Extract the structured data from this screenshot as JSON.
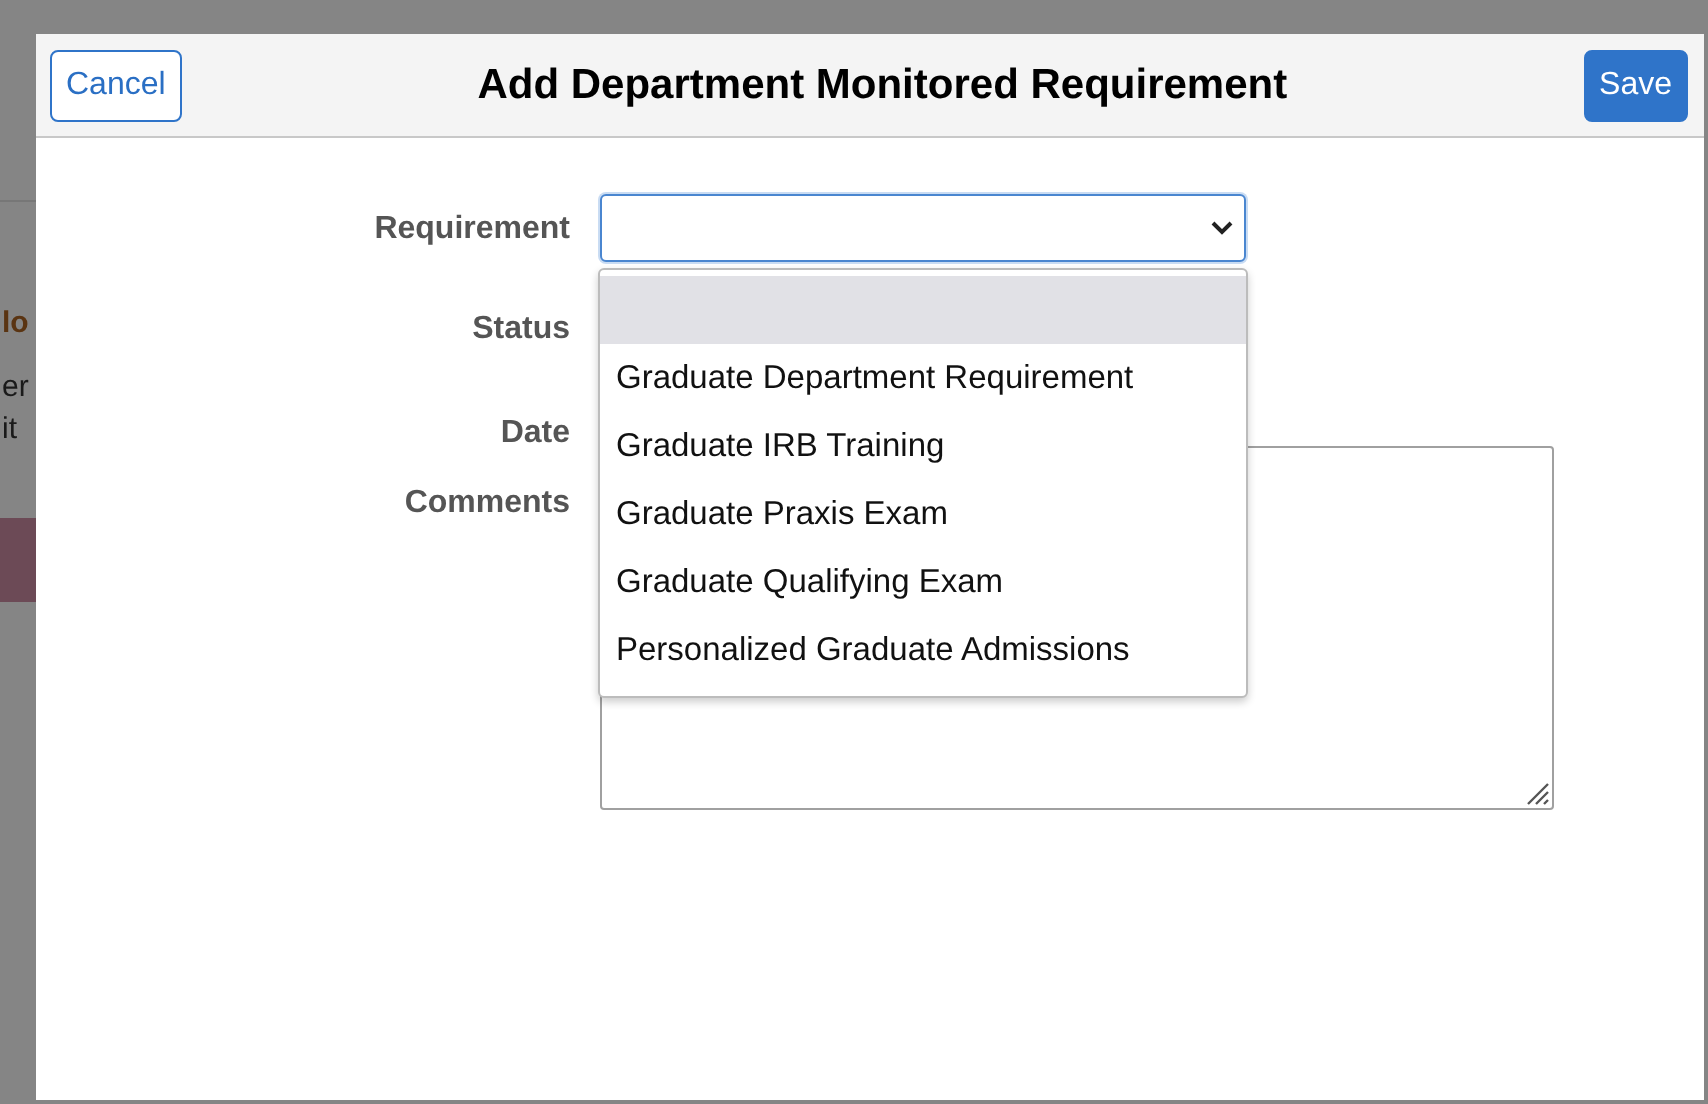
{
  "background_fragments": [
    {
      "text": "lo",
      "kind": "heading"
    },
    {
      "text": "er",
      "kind": "body"
    },
    {
      "text": "it",
      "kind": "body"
    }
  ],
  "dialog": {
    "title": "Add Department Monitored Requirement",
    "cancel_button": "Cancel",
    "save_button": "Save"
  },
  "form": {
    "requirement": {
      "label": "Requirement",
      "expanded": true,
      "options": [
        {
          "selected": true
        },
        {
          "label": "Graduate Department Requirement",
          "selected": false
        },
        {
          "label": "Graduate IRB Training",
          "selected": false
        },
        {
          "label": "Graduate Praxis Exam",
          "selected": false
        },
        {
          "label": "Graduate Qualifying Exam",
          "selected": false
        },
        {
          "label": "Personalized Graduate Admissions",
          "selected": false
        }
      ]
    },
    "status": {
      "label": "Status"
    },
    "date": {
      "label": "Date"
    },
    "comments": {
      "label": "Comments"
    }
  }
}
